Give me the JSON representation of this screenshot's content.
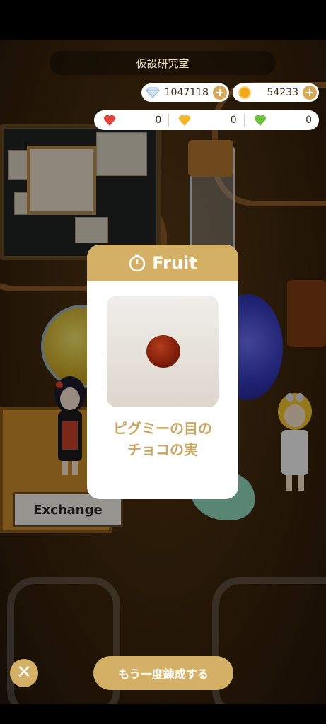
{
  "header": {
    "title": "仮設研究室"
  },
  "currency": {
    "gems": {
      "icon": "diamond-icon",
      "value": "1047118"
    },
    "coins": {
      "icon": "coin-icon",
      "value": "54233"
    },
    "plus_label": "+"
  },
  "hearts": [
    {
      "icon": "red-heart-icon",
      "color": "#e0443a",
      "value": "0"
    },
    {
      "icon": "yellow-heart-icon",
      "color": "#f2b42a",
      "value": "0"
    },
    {
      "icon": "green-heart-icon",
      "color": "#6bbf3a",
      "value": "0"
    }
  ],
  "scene": {
    "sign": "Exchange"
  },
  "result_card": {
    "header_icon": "timer-icon",
    "title": "Fruit",
    "item_name_line1": "ピグミーの目の",
    "item_name_line2": "チョコの実"
  },
  "footer": {
    "close_label": "✕",
    "retry_label": "もう一度錬成する"
  },
  "colors": {
    "accent": "#d4b066",
    "text_gold": "#c9a763"
  }
}
